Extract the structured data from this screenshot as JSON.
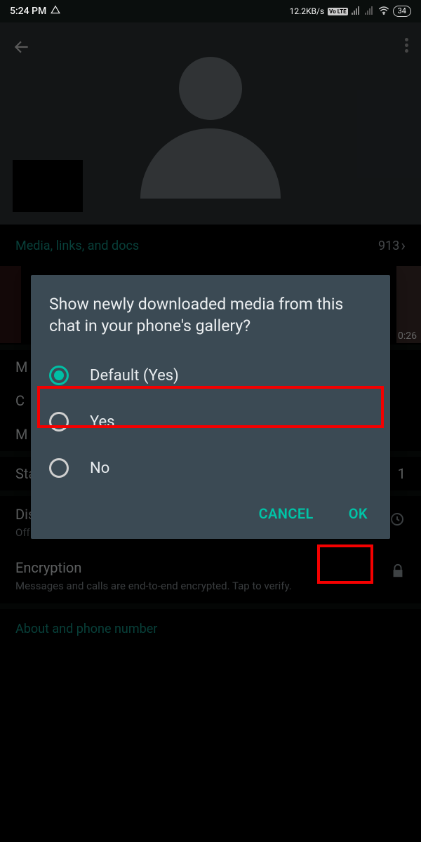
{
  "status": {
    "time": "5:24 PM",
    "speed": "12.2KB/s",
    "volte": "Vo LTE",
    "battery": "34"
  },
  "media": {
    "label": "Media, links, and docs",
    "count": "913",
    "video_duration": "0:26"
  },
  "rows": {
    "m1": "M",
    "c1": "C",
    "m2": "M",
    "starred": "Starred messages",
    "starred_count": "1",
    "disappearing_title": "Disappearing messages",
    "disappearing_sub": "Off",
    "encryption_title": "Encryption",
    "encryption_sub": "Messages and calls are end-to-end encrypted. Tap to verify.",
    "about": "About and phone number"
  },
  "dialog": {
    "title": "Show newly downloaded media from this chat in your phone's gallery?",
    "opt_default": "Default (Yes)",
    "opt_yes": "Yes",
    "opt_no": "No",
    "cancel": "CANCEL",
    "ok": "OK"
  }
}
